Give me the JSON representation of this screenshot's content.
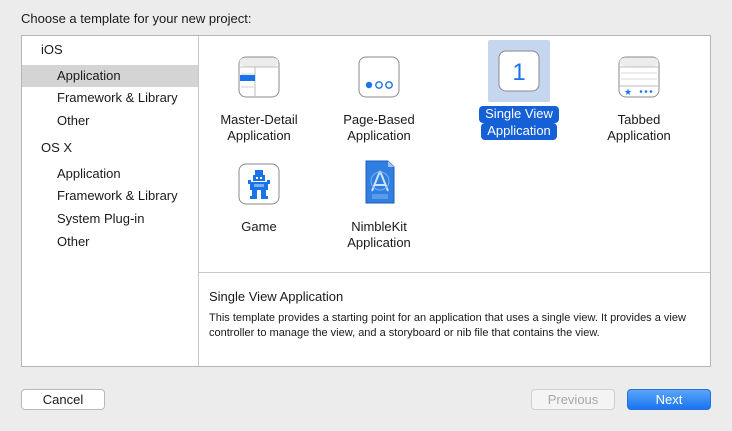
{
  "heading": "Choose a template for your new project:",
  "sidebar": {
    "groups": [
      {
        "label": "iOS",
        "items": [
          "Application",
          "Framework & Library",
          "Other"
        ]
      },
      {
        "label": "OS X",
        "items": [
          "Application",
          "Framework & Library",
          "System Plug-in",
          "Other"
        ]
      }
    ],
    "selected": "iOS / Application"
  },
  "templates": [
    {
      "line1": "Master-Detail",
      "line2": "Application",
      "icon": "master-detail-icon"
    },
    {
      "line1": "Page-Based",
      "line2": "Application",
      "icon": "page-based-icon"
    },
    {
      "line1": "Single View",
      "line2": "Application",
      "icon": "single-view-icon",
      "icon_text": "1",
      "selected": true
    },
    {
      "line1": "Tabbed",
      "line2": "Application",
      "icon": "tabbed-icon"
    },
    {
      "line1": "Game",
      "line2": "",
      "icon": "game-icon"
    },
    {
      "line1": "NimbleKit",
      "line2": "Application",
      "icon": "nimblekit-icon"
    }
  ],
  "description": {
    "title": "Single View Application",
    "body": "This template provides a starting point for an application that uses a single view. It provides a view controller to manage the view, and a storyboard or nib file that contains the view."
  },
  "buttons": {
    "cancel": "Cancel",
    "previous": "Previous",
    "next": "Next"
  },
  "colors": {
    "accent": "#1560d6",
    "selection_bg": "#c5d7ee",
    "sidebar_selected": "#d4d4d4",
    "icon_blue": "#1a73e8"
  }
}
